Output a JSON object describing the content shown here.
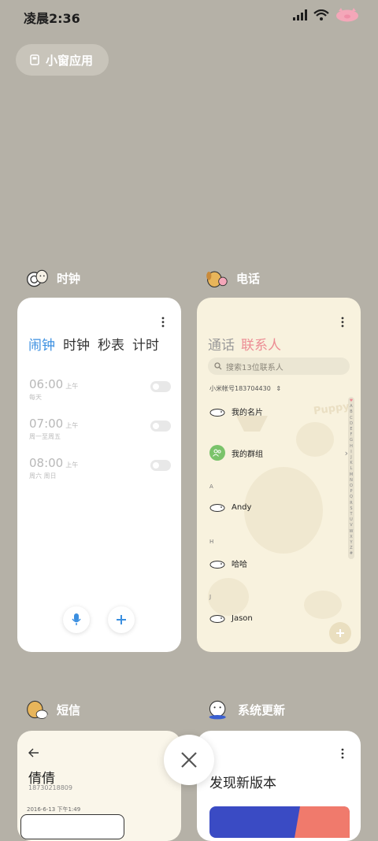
{
  "status_bar": {
    "time": "凌晨2:36",
    "icons": [
      "signal-icon",
      "wifi-icon",
      "battery-pig-icon"
    ]
  },
  "small_window": {
    "label": "小窗应用"
  },
  "cards": {
    "clock": {
      "app_name": "时钟",
      "tabs": [
        "闹钟",
        "时钟",
        "秒表",
        "计时"
      ],
      "alarms": [
        {
          "time": "06:00",
          "ampm": "上午",
          "days": "每天"
        },
        {
          "time": "07:00",
          "ampm": "上午",
          "days": "周一至周五"
        },
        {
          "time": "08:00",
          "ampm": "上午",
          "days": "周六 周日"
        }
      ]
    },
    "phone": {
      "app_name": "电话",
      "tabs": [
        "通话",
        "联系人"
      ],
      "search_placeholder": "搜索13位联系人",
      "account": "小米帐号183704430",
      "contacts": [
        {
          "name": "我的名片"
        },
        {
          "name": "我的群组"
        },
        {
          "section": "A",
          "name": "Andy"
        },
        {
          "section": "H",
          "name": "哈哈"
        },
        {
          "section": "J",
          "name": "Jason"
        }
      ],
      "index_letters": [
        "♥",
        "A",
        "B",
        "C",
        "D",
        "E",
        "F",
        "G",
        "H",
        "I",
        "J",
        "K",
        "L",
        "M",
        "N",
        "O",
        "P",
        "Q",
        "R",
        "S",
        "T",
        "U",
        "V",
        "W",
        "X",
        "Y",
        "Z",
        "#"
      ],
      "watermark": "Puppy"
    },
    "sms": {
      "app_name": "短信",
      "contact_name": "倩倩",
      "contact_number": "18730218809",
      "timestamp": "2016-6-13 下午1:49"
    },
    "update": {
      "app_name": "系统更新",
      "title": "发现新版本"
    }
  },
  "colors": {
    "accent_blue": "#3b8fe0",
    "accent_pink": "#ec8c94",
    "background": "#b5b1a7"
  }
}
